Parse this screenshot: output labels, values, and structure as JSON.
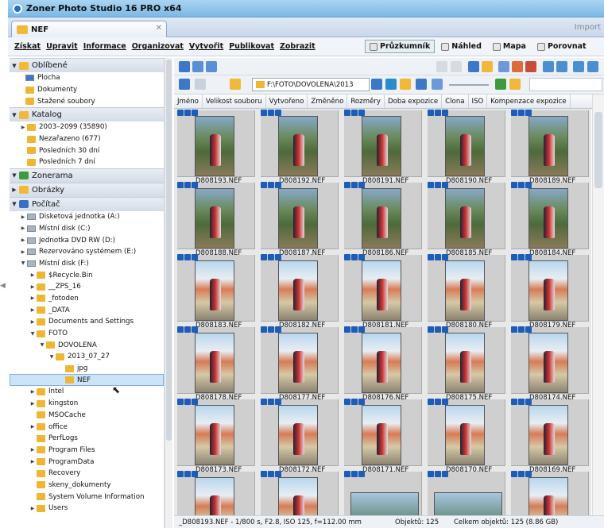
{
  "window": {
    "title": "Zoner Photo Studio 16 PRO x64"
  },
  "tab": {
    "label": "NEF",
    "import_label": "Import"
  },
  "menu": [
    "Získat",
    "Upravit",
    "Informace",
    "Organizovat",
    "Vytvořit",
    "Publikovat",
    "Zobrazit"
  ],
  "modes": [
    "Průzkumník",
    "Náhled",
    "Mapa",
    "Porovnat"
  ],
  "tree": {
    "favorites": {
      "label": "Oblíbené",
      "items": [
        "Plocha",
        "Dokumenty",
        "Stažené soubory"
      ]
    },
    "catalog": {
      "label": "Katalog",
      "items": [
        "2003–2099 (35890)",
        "Nezařazeno (677)",
        "Posledních 30 dní",
        "Posledních 7 dní"
      ]
    },
    "zonerama": {
      "label": "Zonerama"
    },
    "pictures": {
      "label": "Obrázky"
    },
    "computer": {
      "label": "Počítač"
    },
    "drives": [
      "Disketová jednotka (A:)",
      "Místní disk (C:)",
      "Jednotka DVD RW (D:)",
      "Rezervováno systémem (E:)",
      "Místní disk (F:)"
    ],
    "f_folders": [
      "$Recycle.Bin",
      "__ZPS_16",
      "_fotoden",
      "_DATA",
      "Documents and Settings",
      "FOTO",
      "DOVOLENA",
      "2013_07_27",
      "jpg",
      "NEF",
      "Intel",
      "kingston",
      "MSOCache",
      "office",
      "PerfLogs",
      "Program Files",
      "ProgramData",
      "Recovery",
      "skeny_dokumenty",
      "System Volume Information",
      "Users"
    ]
  },
  "path": "F:\\FOTO\\DOVOLENA\\2013",
  "columns": [
    "Jméno",
    "Velikost souboru",
    "Vytvořeno",
    "Změněno",
    "Rozměry",
    "Doba expozice",
    "Clona",
    "ISO",
    "Kompenzace expozice"
  ],
  "files": [
    "_D808193.NEF",
    "_D808192.NEF",
    "_D808191.NEF",
    "_D808190.NEF",
    "_D808189.NEF",
    "_D808188.NEF",
    "_D808187.NEF",
    "_D808186.NEF",
    "_D808185.NEF",
    "_D808184.NEF",
    "_D808183.NEF",
    "_D808182.NEF",
    "_D808181.NEF",
    "_D808180.NEF",
    "_D808179.NEF",
    "_D808178.NEF",
    "_D808177.NEF",
    "_D808176.NEF",
    "_D808175.NEF",
    "_D808174.NEF",
    "_D808173.NEF",
    "_D808172.NEF",
    "_D808171.NEF",
    "_D808170.NEF",
    "_D808169.NEF",
    "",
    "",
    "",
    "",
    ""
  ],
  "status": {
    "info": "_D808193.NEF - 1/800 s, F2.8, ISO 125, f=112.00 mm",
    "objects": "Objektů: 125",
    "total": "Celkem objektů: 125 (8.86 GB)"
  }
}
